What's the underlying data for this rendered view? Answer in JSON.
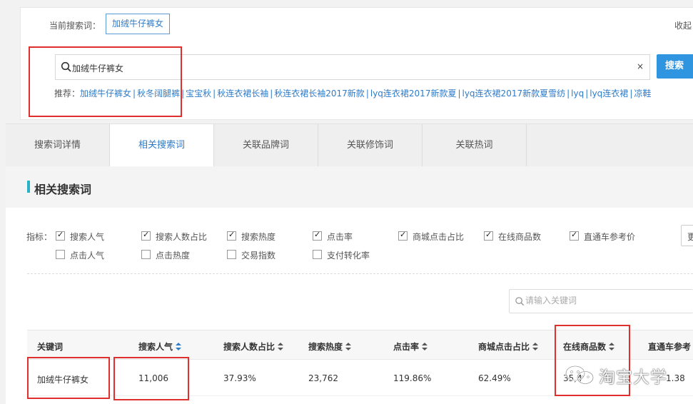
{
  "search": {
    "current_label": "当前搜索词：",
    "current_term": "加绒牛仔裤女",
    "collapse_label": "收起",
    "value": "加绒牛仔裤女",
    "clear": "×",
    "button": "搜索",
    "recommend_label": "推荐：",
    "recommend": [
      "加绒牛仔裤女",
      "秋冬阔腿裤",
      "宝宝秋",
      "秋连衣裙长袖",
      "秋连衣裙长袖2017新款",
      "lyq连衣裙2017新款夏",
      "lyq连衣裙2017新款夏雪纺",
      "lyq",
      "lyq连衣裙",
      "凉鞋"
    ]
  },
  "tabs": [
    "搜索词详情",
    "相关搜索词",
    "关联品牌词",
    "关联修饰词",
    "关联热词"
  ],
  "active_tab": 1,
  "section_title": "相关搜索词",
  "indicators": {
    "label": "指标：",
    "items": [
      {
        "label": "搜索人气",
        "checked": true
      },
      {
        "label": "搜索人数占比",
        "checked": true
      },
      {
        "label": "搜索热度",
        "checked": true
      },
      {
        "label": "点击率",
        "checked": true
      },
      {
        "label": "商城点击占比",
        "checked": true
      },
      {
        "label": "在线商品数",
        "checked": true
      },
      {
        "label": "直通车参考价",
        "checked": true
      },
      {
        "label": "点击人气",
        "checked": false
      },
      {
        "label": "点击热度",
        "checked": false
      },
      {
        "label": "交易指数",
        "checked": false
      },
      {
        "label": "支付转化率",
        "checked": false
      }
    ],
    "more_button": "更"
  },
  "keyword_search": {
    "placeholder": "请输入关键词"
  },
  "table": {
    "headers": [
      "关键词",
      "搜索人气",
      "搜索人数占比",
      "搜索热度",
      "点击率",
      "商城点击占比",
      "在线商品数",
      "直通车参考"
    ],
    "rows": [
      [
        "加绒牛仔裤女",
        "11,006",
        "37.93%",
        "23,762",
        "119.86%",
        "62.49%",
        "35,4",
        "1.38"
      ]
    ]
  },
  "watermark": "淘宝大学",
  "colors": {
    "accent": "#2f7bc8",
    "button": "#2f95e0",
    "section_bar": "#29b1c7",
    "annotation": "#e0302d"
  }
}
